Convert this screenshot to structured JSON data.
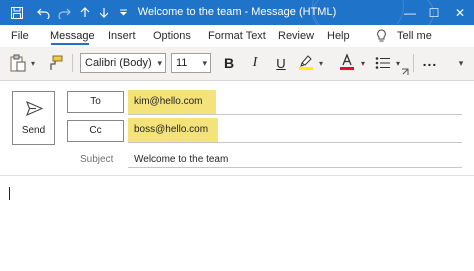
{
  "window": {
    "title": "Welcome to the team  -  Message (HTML)",
    "minimize_glyph": "—",
    "maximize_glyph": "☐",
    "close_glyph": "✕"
  },
  "ribbon": {
    "tabs": [
      {
        "label": "File"
      },
      {
        "label": "Message"
      },
      {
        "label": "Insert"
      },
      {
        "label": "Options"
      },
      {
        "label": "Format Text"
      },
      {
        "label": "Review"
      },
      {
        "label": "Help"
      }
    ],
    "active_tab": "Message",
    "tell_me": "Tell me"
  },
  "toolbar": {
    "font_name": "Calibri (Body)",
    "font_size": "11",
    "bold_label": "B",
    "italic_label": "I",
    "underline_label": "U",
    "more_label": "...",
    "highlight_color": "#ffef00",
    "font_color": "#e81123"
  },
  "compose": {
    "send_label": "Send",
    "to_label": "To",
    "to_value": "kim@hello.com",
    "cc_label": "Cc",
    "cc_value": "boss@hello.com",
    "subject_label": "Subject",
    "subject_value": "Welcome to the team",
    "highlight_color": "#f4e27a"
  },
  "colors": {
    "title_bar": "#1f73c8",
    "accent": "#1f73c8"
  }
}
